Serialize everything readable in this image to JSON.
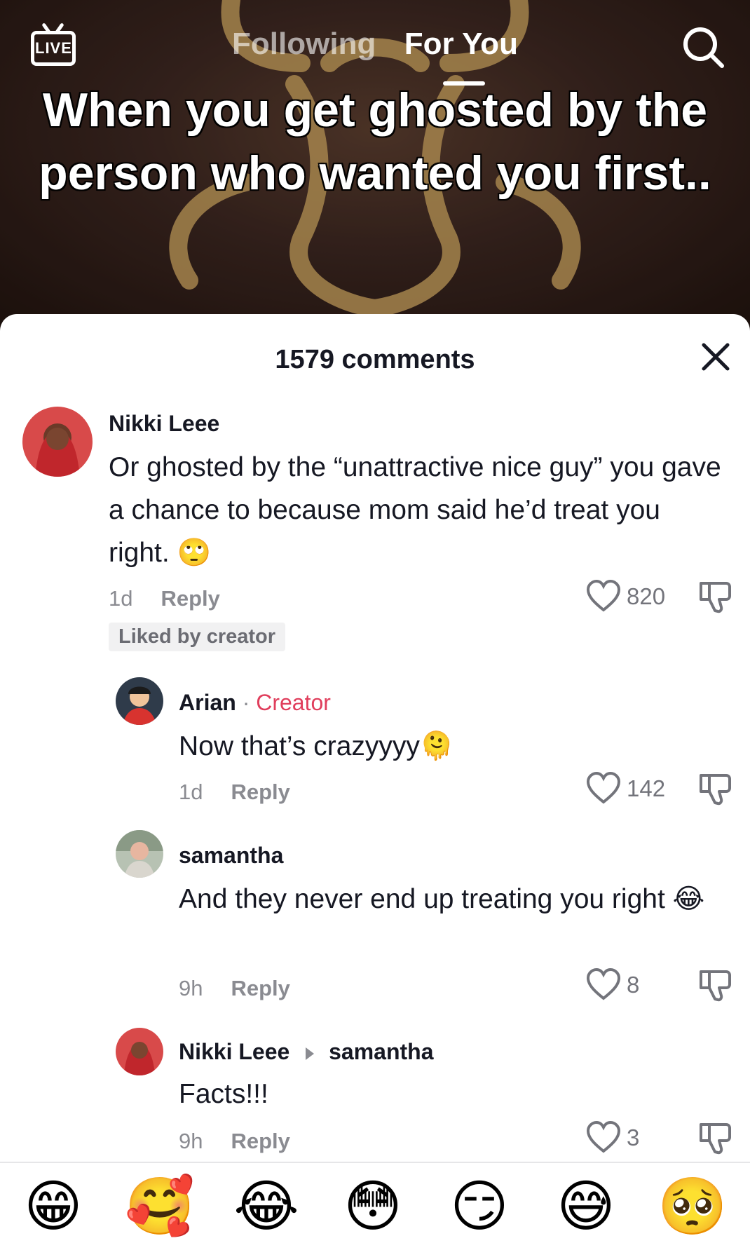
{
  "top_nav": {
    "live_label": "LIVE",
    "tabs": [
      {
        "label": "Following",
        "active": false
      },
      {
        "label": "For You",
        "active": true
      }
    ]
  },
  "video": {
    "caption": "When you get ghosted by the person who wanted you first.."
  },
  "comments_panel": {
    "title": "1579 comments",
    "comments": [
      {
        "author": "Nikki Leee",
        "text": "Or ghosted by the “unattractive nice guy” you gave a chance to because mom said he’d treat you right. 🙄",
        "time": "1d",
        "reply_label": "Reply",
        "likes": "820",
        "badge": "Liked by creator"
      },
      {
        "author": "Arian",
        "separator": "·",
        "author_tag": "Creator",
        "text": "Now that’s crazyyyy🫠",
        "time": "1d",
        "reply_label": "Reply",
        "likes": "142"
      },
      {
        "author": "samantha",
        "text": "And they never end up treating you right 😂",
        "time": "9h",
        "reply_label": "Reply",
        "likes": "8"
      },
      {
        "author": "Nikki Leee",
        "reply_to": "samantha",
        "text": "Facts!!!",
        "time": "9h",
        "reply_label": "Reply",
        "likes": "3"
      }
    ]
  },
  "emoji_bar": [
    "😁",
    "🥰",
    "😂",
    "😳",
    "😏",
    "😅",
    "🥺"
  ],
  "colors": {
    "creator_tag": "#e03e5c",
    "text_primary": "#161823",
    "text_secondary": "#8a8b91"
  }
}
